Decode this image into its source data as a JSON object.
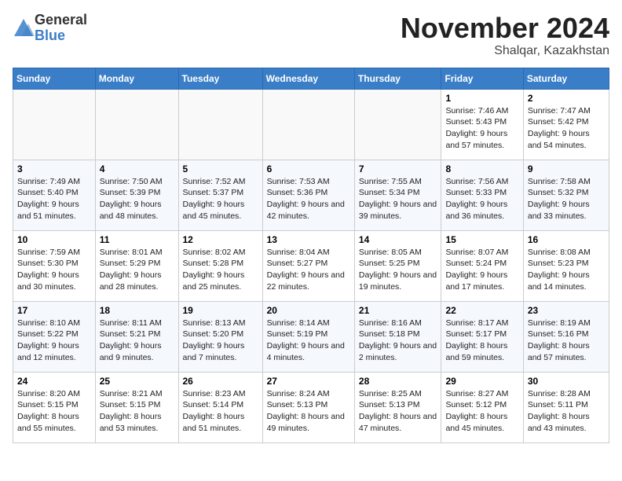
{
  "header": {
    "logo_general": "General",
    "logo_blue": "Blue",
    "month": "November 2024",
    "location": "Shalqar, Kazakhstan"
  },
  "days_of_week": [
    "Sunday",
    "Monday",
    "Tuesday",
    "Wednesday",
    "Thursday",
    "Friday",
    "Saturday"
  ],
  "weeks": [
    [
      {
        "day": "",
        "sunrise": "",
        "sunset": "",
        "daylight": ""
      },
      {
        "day": "",
        "sunrise": "",
        "sunset": "",
        "daylight": ""
      },
      {
        "day": "",
        "sunrise": "",
        "sunset": "",
        "daylight": ""
      },
      {
        "day": "",
        "sunrise": "",
        "sunset": "",
        "daylight": ""
      },
      {
        "day": "",
        "sunrise": "",
        "sunset": "",
        "daylight": ""
      },
      {
        "day": "1",
        "sunrise": "Sunrise: 7:46 AM",
        "sunset": "Sunset: 5:43 PM",
        "daylight": "Daylight: 9 hours and 57 minutes."
      },
      {
        "day": "2",
        "sunrise": "Sunrise: 7:47 AM",
        "sunset": "Sunset: 5:42 PM",
        "daylight": "Daylight: 9 hours and 54 minutes."
      }
    ],
    [
      {
        "day": "3",
        "sunrise": "Sunrise: 7:49 AM",
        "sunset": "Sunset: 5:40 PM",
        "daylight": "Daylight: 9 hours and 51 minutes."
      },
      {
        "day": "4",
        "sunrise": "Sunrise: 7:50 AM",
        "sunset": "Sunset: 5:39 PM",
        "daylight": "Daylight: 9 hours and 48 minutes."
      },
      {
        "day": "5",
        "sunrise": "Sunrise: 7:52 AM",
        "sunset": "Sunset: 5:37 PM",
        "daylight": "Daylight: 9 hours and 45 minutes."
      },
      {
        "day": "6",
        "sunrise": "Sunrise: 7:53 AM",
        "sunset": "Sunset: 5:36 PM",
        "daylight": "Daylight: 9 hours and 42 minutes."
      },
      {
        "day": "7",
        "sunrise": "Sunrise: 7:55 AM",
        "sunset": "Sunset: 5:34 PM",
        "daylight": "Daylight: 9 hours and 39 minutes."
      },
      {
        "day": "8",
        "sunrise": "Sunrise: 7:56 AM",
        "sunset": "Sunset: 5:33 PM",
        "daylight": "Daylight: 9 hours and 36 minutes."
      },
      {
        "day": "9",
        "sunrise": "Sunrise: 7:58 AM",
        "sunset": "Sunset: 5:32 PM",
        "daylight": "Daylight: 9 hours and 33 minutes."
      }
    ],
    [
      {
        "day": "10",
        "sunrise": "Sunrise: 7:59 AM",
        "sunset": "Sunset: 5:30 PM",
        "daylight": "Daylight: 9 hours and 30 minutes."
      },
      {
        "day": "11",
        "sunrise": "Sunrise: 8:01 AM",
        "sunset": "Sunset: 5:29 PM",
        "daylight": "Daylight: 9 hours and 28 minutes."
      },
      {
        "day": "12",
        "sunrise": "Sunrise: 8:02 AM",
        "sunset": "Sunset: 5:28 PM",
        "daylight": "Daylight: 9 hours and 25 minutes."
      },
      {
        "day": "13",
        "sunrise": "Sunrise: 8:04 AM",
        "sunset": "Sunset: 5:27 PM",
        "daylight": "Daylight: 9 hours and 22 minutes."
      },
      {
        "day": "14",
        "sunrise": "Sunrise: 8:05 AM",
        "sunset": "Sunset: 5:25 PM",
        "daylight": "Daylight: 9 hours and 19 minutes."
      },
      {
        "day": "15",
        "sunrise": "Sunrise: 8:07 AM",
        "sunset": "Sunset: 5:24 PM",
        "daylight": "Daylight: 9 hours and 17 minutes."
      },
      {
        "day": "16",
        "sunrise": "Sunrise: 8:08 AM",
        "sunset": "Sunset: 5:23 PM",
        "daylight": "Daylight: 9 hours and 14 minutes."
      }
    ],
    [
      {
        "day": "17",
        "sunrise": "Sunrise: 8:10 AM",
        "sunset": "Sunset: 5:22 PM",
        "daylight": "Daylight: 9 hours and 12 minutes."
      },
      {
        "day": "18",
        "sunrise": "Sunrise: 8:11 AM",
        "sunset": "Sunset: 5:21 PM",
        "daylight": "Daylight: 9 hours and 9 minutes."
      },
      {
        "day": "19",
        "sunrise": "Sunrise: 8:13 AM",
        "sunset": "Sunset: 5:20 PM",
        "daylight": "Daylight: 9 hours and 7 minutes."
      },
      {
        "day": "20",
        "sunrise": "Sunrise: 8:14 AM",
        "sunset": "Sunset: 5:19 PM",
        "daylight": "Daylight: 9 hours and 4 minutes."
      },
      {
        "day": "21",
        "sunrise": "Sunrise: 8:16 AM",
        "sunset": "Sunset: 5:18 PM",
        "daylight": "Daylight: 9 hours and 2 minutes."
      },
      {
        "day": "22",
        "sunrise": "Sunrise: 8:17 AM",
        "sunset": "Sunset: 5:17 PM",
        "daylight": "Daylight: 8 hours and 59 minutes."
      },
      {
        "day": "23",
        "sunrise": "Sunrise: 8:19 AM",
        "sunset": "Sunset: 5:16 PM",
        "daylight": "Daylight: 8 hours and 57 minutes."
      }
    ],
    [
      {
        "day": "24",
        "sunrise": "Sunrise: 8:20 AM",
        "sunset": "Sunset: 5:15 PM",
        "daylight": "Daylight: 8 hours and 55 minutes."
      },
      {
        "day": "25",
        "sunrise": "Sunrise: 8:21 AM",
        "sunset": "Sunset: 5:15 PM",
        "daylight": "Daylight: 8 hours and 53 minutes."
      },
      {
        "day": "26",
        "sunrise": "Sunrise: 8:23 AM",
        "sunset": "Sunset: 5:14 PM",
        "daylight": "Daylight: 8 hours and 51 minutes."
      },
      {
        "day": "27",
        "sunrise": "Sunrise: 8:24 AM",
        "sunset": "Sunset: 5:13 PM",
        "daylight": "Daylight: 8 hours and 49 minutes."
      },
      {
        "day": "28",
        "sunrise": "Sunrise: 8:25 AM",
        "sunset": "Sunset: 5:13 PM",
        "daylight": "Daylight: 8 hours and 47 minutes."
      },
      {
        "day": "29",
        "sunrise": "Sunrise: 8:27 AM",
        "sunset": "Sunset: 5:12 PM",
        "daylight": "Daylight: 8 hours and 45 minutes."
      },
      {
        "day": "30",
        "sunrise": "Sunrise: 8:28 AM",
        "sunset": "Sunset: 5:11 PM",
        "daylight": "Daylight: 8 hours and 43 minutes."
      }
    ]
  ]
}
